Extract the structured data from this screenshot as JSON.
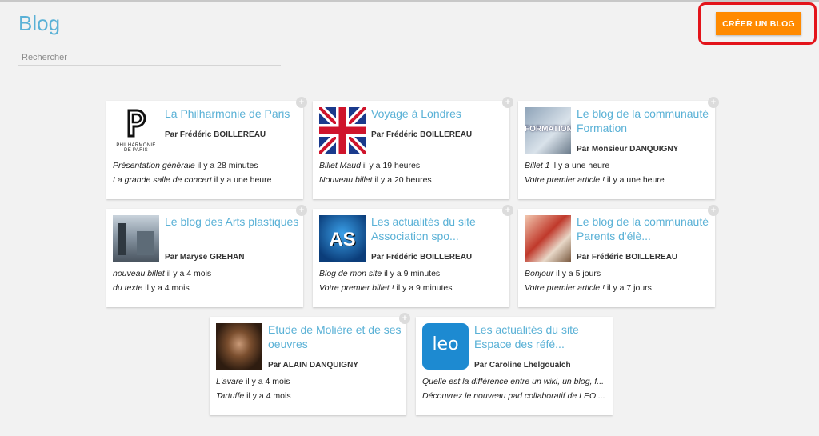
{
  "header": {
    "title": "Blog",
    "search_placeholder": "Rechercher",
    "create_label": "CRÉER UN BLOG"
  },
  "colors": {
    "accent": "#ff8a00",
    "title": "#5ab1d6",
    "highlight": "#e3141b"
  },
  "blogs": [
    {
      "title": "La Philharmonie de Paris",
      "author": "Par Frédéric BOILLEREAU",
      "thumb_icon": "philharmonie-logo",
      "thumb_text_1": "PHILHARMONIE",
      "thumb_text_2": "DE PARIS",
      "entries": [
        {
          "name": "Présentation générale",
          "time": " il y a 28 minutes"
        },
        {
          "name": "La grande salle de concert",
          "time": " il y a une heure"
        }
      ]
    },
    {
      "title": "Voyage à Londres",
      "author": "Par Frédéric BOILLEREAU",
      "thumb_icon": "union-jack-flag",
      "entries": [
        {
          "name": "Billet Maud",
          "time": " il y a 19 heures"
        },
        {
          "name": "Nouveau billet",
          "time": " il y a 20 heures"
        }
      ]
    },
    {
      "title": "Le blog de la communauté Formation",
      "author": "Par Monsieur DANQUIGNY",
      "thumb_icon": "formation-photo",
      "thumb_text_1": "FORMATION",
      "entries": [
        {
          "name": "Billet 1",
          "time": " il y a une heure"
        },
        {
          "name": "Votre premier article !",
          "time": " il y a une heure"
        }
      ]
    },
    {
      "title": "Le blog des Arts plastiques",
      "author": "Par Maryse GREHAN",
      "thumb_icon": "arts-room-photo",
      "entries": [
        {
          "name": "nouveau billet",
          "time": " il y a 4 mois"
        },
        {
          "name": "du texte",
          "time": " il y a 4 mois"
        }
      ]
    },
    {
      "title": "Les actualités du site Association spo...",
      "author": "Par Frédéric BOILLEREAU",
      "thumb_icon": "sport-association-logo",
      "thumb_text_1": "AS",
      "entries": [
        {
          "name": "Blog de mon site",
          "time": " il y a 9 minutes"
        },
        {
          "name": "Votre premier billet !",
          "time": " il y a 9 minutes"
        }
      ]
    },
    {
      "title": "Le blog de la communauté Parents d'élè...",
      "author": "Par Frédéric BOILLEREAU",
      "thumb_icon": "parents-photo",
      "entries": [
        {
          "name": "Bonjour",
          "time": " il y a 5 jours"
        },
        {
          "name": "Votre premier article !",
          "time": " il y a 7 jours"
        }
      ]
    },
    {
      "title": "Etude de Molière et de ses oeuvres",
      "author": "Par ALAIN DANQUIGNY",
      "thumb_icon": "moliere-portrait",
      "entries": [
        {
          "name": "L'avare",
          "time": " il y a 4 mois"
        },
        {
          "name": "Tartuffe",
          "time": " il y a 4 mois"
        }
      ]
    },
    {
      "title": "Les actualités du site Espace des réfé...",
      "author": "Par Caroline Lhelgoualch",
      "thumb_icon": "leo-logo",
      "thumb_text_1": "leo",
      "entries": [
        {
          "name": "Quelle est la différence entre un wiki, un blog, f...",
          "time": ""
        },
        {
          "name": "Découvrez le nouveau pad collaboratif de LEO ...",
          "time": ""
        }
      ]
    }
  ]
}
